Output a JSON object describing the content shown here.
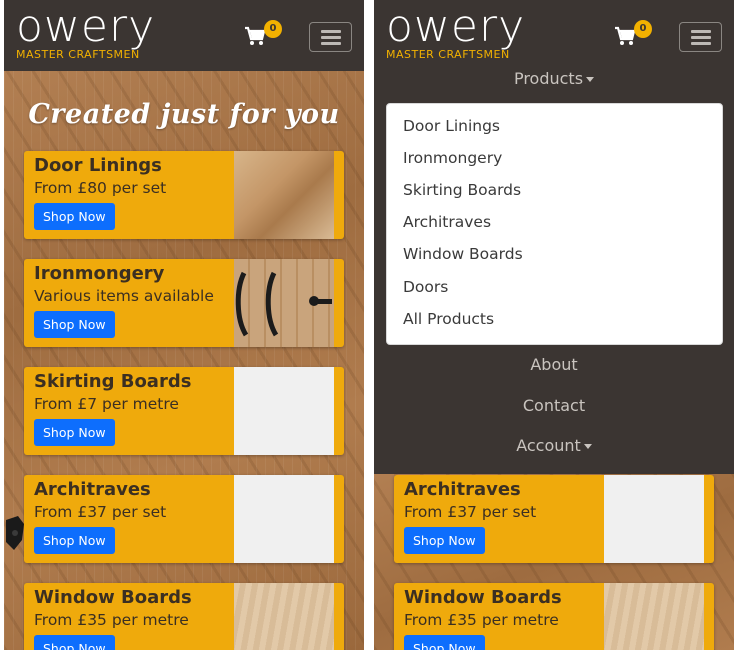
{
  "brand": {
    "name": "owery",
    "tagline": "MASTER CRAFTSMEN"
  },
  "cart": {
    "count": "0"
  },
  "hero": {
    "title": "Created just for you"
  },
  "cards": [
    {
      "title": "Door Linings",
      "subtitle": "From £80 per set",
      "button": "Shop Now"
    },
    {
      "title": "Ironmongery",
      "subtitle": "Various items available",
      "button": "Shop Now"
    },
    {
      "title": "Skirting Boards",
      "subtitle": "From £7 per metre",
      "button": "Shop Now"
    },
    {
      "title": "Architraves",
      "subtitle": "From £37 per set",
      "button": "Shop Now"
    },
    {
      "title": "Window Boards",
      "subtitle": "From £35 per metre",
      "button": "Shop Now"
    }
  ],
  "menu": {
    "products_label": "Products",
    "dropdown_items": [
      "Door Linings",
      "Ironmongery",
      "Skirting Boards",
      "Architraves",
      "Window Boards",
      "Doors",
      "All Products"
    ],
    "about": "About",
    "contact": "Contact",
    "account": "Account"
  },
  "colors": {
    "accent": "#efaa0c",
    "navbar": "#3b3532",
    "button": "#0d6efd"
  }
}
